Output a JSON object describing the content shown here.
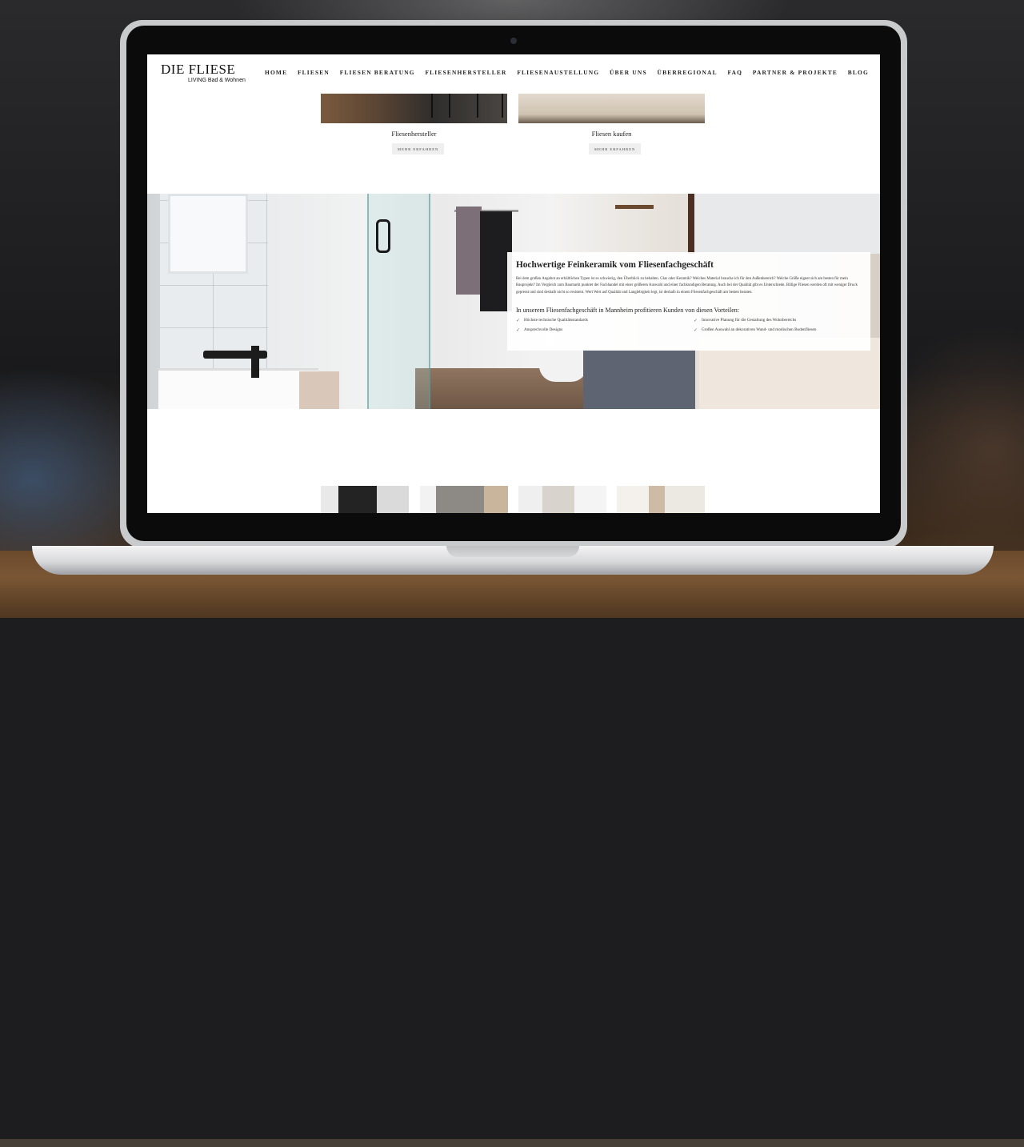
{
  "site": {
    "logo_main": "DIE FLIESE",
    "logo_sub": "LIVING Bad & Wohnen"
  },
  "nav": {
    "items": [
      "HOME",
      "FLIESEN",
      "FLIESEN BERATUNG",
      "FLIESENHERSTELLER",
      "FLIESENAUSTELLUNG",
      "ÜBER UNS",
      "ÜBERREGIONAL",
      "FAQ",
      "PARTNER & PROJEKTE",
      "BLOG"
    ]
  },
  "cards": [
    {
      "title": "Fliesenhersteller",
      "button": "MEHR ERFAHREN"
    },
    {
      "title": "Fliesen kaufen",
      "button": "MEHR ERFAHREN"
    }
  ],
  "info": {
    "title": "Hochwertige Feinkeramik vom Fliesenfachgeschäft",
    "body": "Bei dem großen Angebot an erhältlichen Typen ist es schwierig, den Überblick zu behalten. Glas oder Keramik? Welches Material brauche ich für den Außenbereich? Welche Größe eignet sich am besten für mein Bauprojekt? Im Vergleich zum Baumarkt punktet der Fachhandel mit einer größeren Auswahl und einer fachkundigen Beratung. Auch bei der Qualität gibt es Unterschiede. Billige Fliesen werden oft mit weniger Druck gepresst und sind deshalb nicht so resistent. Wert Wert auf Qualität und Langlebigkeit legt, ist deshalb in einem Fliesenfachgeschäft am besten beraten.",
    "subtitle": "In unserem Fliesenfachgeschäft in Mannheim profitieren Kunden von diesen Vorteilen:",
    "benefits": [
      "Höchste technische Qualitätsstandards",
      "Innovative Planung für die Gestaltung des Wohnbereichs",
      "Ansprechvolle Designs",
      "Großen Auswahl an dekorativen Wand- und modischen Bodenfliesen"
    ]
  },
  "icons": {
    "benefit_marker": "check-icon"
  }
}
